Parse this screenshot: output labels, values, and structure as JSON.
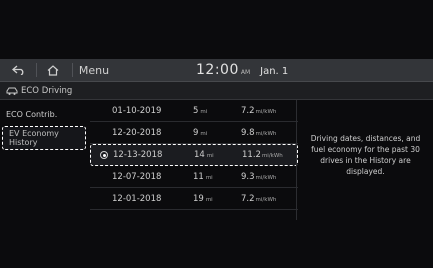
{
  "topbar": {
    "back_icon": "back-arrow-icon",
    "home_icon": "home-icon",
    "menu_label": "Menu",
    "clock": "12:00",
    "ampm": "AM",
    "date": "Jan. 1"
  },
  "title": {
    "icon": "eco-car-icon",
    "label": "ECO Driving"
  },
  "leftmenu": {
    "items": [
      {
        "label": "ECO Contrib."
      },
      {
        "label_line1": "EV Economy",
        "label_line2": "History"
      }
    ]
  },
  "history": {
    "rows": [
      {
        "date": "01-10-2019",
        "distance": "5",
        "distance_unit": "mi",
        "economy": "7.2",
        "economy_unit": "mi/kWh"
      },
      {
        "date": "12-20-2018",
        "distance": "9",
        "distance_unit": "mi",
        "economy": "9.8",
        "economy_unit": "mi/kWh"
      },
      {
        "date": "12-13-2018",
        "distance": "14",
        "distance_unit": "mi",
        "economy": "11.2",
        "economy_unit": "mi/kWh"
      },
      {
        "date": "12-07-2018",
        "distance": "11",
        "distance_unit": "mi",
        "economy": "9.3",
        "economy_unit": "mi/kWh"
      },
      {
        "date": "12-01-2018",
        "distance": "19",
        "distance_unit": "mi",
        "economy": "7.2",
        "economy_unit": "mi/kWh"
      }
    ],
    "selected_index": 2
  },
  "info": {
    "line1": "Driving dates, distances, and",
    "line2": "fuel economy for the past 30",
    "line3": "drives in the History are",
    "line4": "displayed."
  }
}
